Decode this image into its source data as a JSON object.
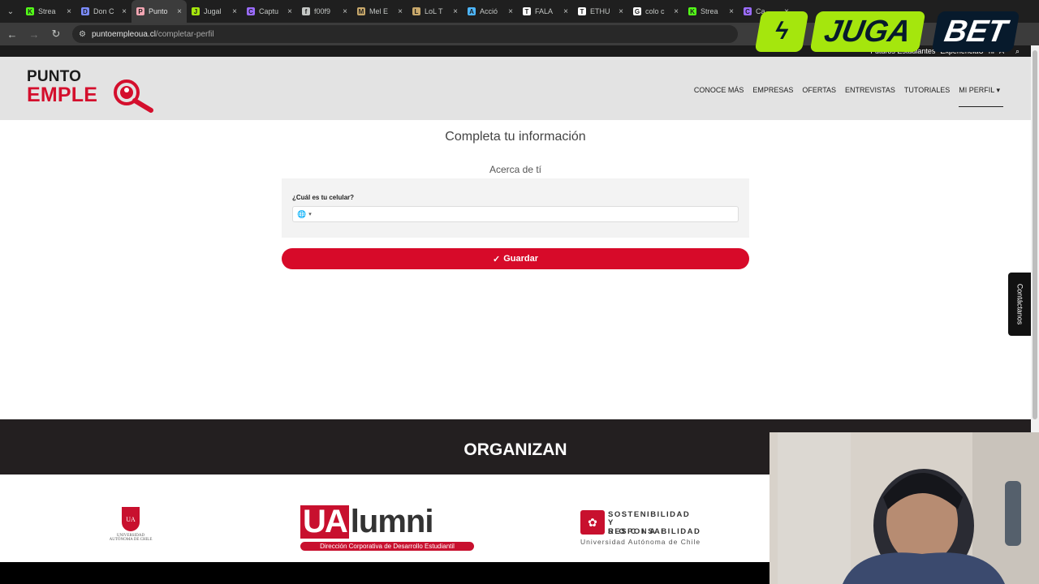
{
  "browser": {
    "tabs": [
      {
        "label": "Strea",
        "fav_color": "#53fc18",
        "fav_glyph": "K"
      },
      {
        "label": "Don C",
        "fav_color": "#7b8cff",
        "fav_glyph": "D"
      },
      {
        "label": "Punto",
        "fav_color": "#f2a6b3",
        "fav_glyph": "P",
        "active": true
      },
      {
        "label": "Jugal",
        "fav_color": "#a5e60d",
        "fav_glyph": "J"
      },
      {
        "label": "Captu",
        "fav_color": "#9b6cff",
        "fav_glyph": "C"
      },
      {
        "label": "f00f9",
        "fav_color": "#c4c7c5",
        "fav_glyph": "f"
      },
      {
        "label": "Mel E",
        "fav_color": "#c8a86b",
        "fav_glyph": "M"
      },
      {
        "label": "LoL T",
        "fav_color": "#c8a86b",
        "fav_glyph": "L"
      },
      {
        "label": "Acció",
        "fav_color": "#4db6ff",
        "fav_glyph": "A"
      },
      {
        "label": "FALA",
        "fav_color": "#ffffff",
        "fav_glyph": "T"
      },
      {
        "label": "ETHU",
        "fav_color": "#ffffff",
        "fav_glyph": "T"
      },
      {
        "label": "colo c",
        "fav_color": "#ffffff",
        "fav_glyph": "G"
      },
      {
        "label": "Strea",
        "fav_color": "#53fc18",
        "fav_glyph": "K"
      },
      {
        "label": "Ca",
        "fav_color": "#9b6cff",
        "fav_glyph": "C"
      }
    ],
    "url_host": "puntoempleoua.cl",
    "url_path": "/completar-perfil"
  },
  "site": {
    "topstrip": [
      "Futuros Estudiantes",
      "ExperienciaU",
      "ni",
      "A"
    ],
    "logo_line1": "PUNTO",
    "logo_line2": "EMPLE",
    "nav": [
      "CONOCE MÁS",
      "EMPRESAS",
      "OFERTAS",
      "ENTREVISTAS",
      "TUTORIALES"
    ],
    "nav_profile": "MI PERFIL",
    "brand_red": "#d70a29"
  },
  "form": {
    "title": "Completa tu información",
    "section": "Acerca de tí",
    "phone_question": "¿Cuál es tu celular?",
    "phone_value": "",
    "save_label": "Guardar"
  },
  "contact_tab": "Contáctanos",
  "footer": {
    "organizan": "ORGANIZAN",
    "ua_name": "UNIVERSIDAD AUTÓNOMA DE CHILE",
    "ua_shield": "UA",
    "ualumni_ua": "UA",
    "ualumni_rest": "lumni",
    "ualumni_sub": "Dirección Corporativa de Desarrollo Estudiantil",
    "sost_line1": "SOSTENIBILIDAD",
    "sost_line2": "Y RESPONSABILIDAD",
    "sost_line3": "SOCIAL",
    "sost_uni": "Universidad Autónoma de Chile"
  },
  "overlay": {
    "jugabet_juga": "JUGA",
    "jugabet_bet": "BET"
  }
}
